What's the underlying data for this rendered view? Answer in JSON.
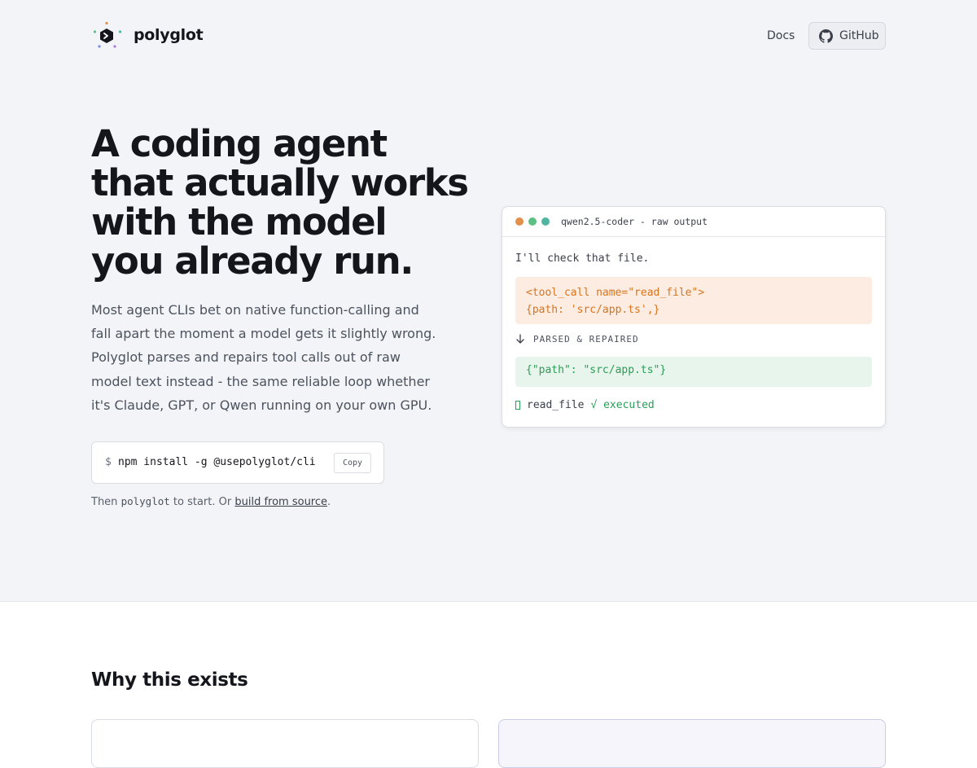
{
  "header": {
    "brand": "polyglot",
    "logo_icon": "polyglot-logo-icon",
    "nav": {
      "docs_label": "Docs",
      "github_label": "GitHub",
      "github_icon": "github-icon"
    }
  },
  "hero": {
    "headline_lines": [
      "A coding agent",
      "that actually works",
      "with the model",
      "you already run."
    ],
    "lede": "Most agent CLIs bet on native function-calling and fall apart the moment a model gets it slightly wrong. Polyglot parses and repairs tool calls out of raw model text instead - the same reliable loop whether it's Claude, GPT, or Qwen running on your own GPU.",
    "install": {
      "prompt": "$",
      "command": "npm install -g @usepolyglot/cli",
      "copy_label": "Copy"
    },
    "then": {
      "prefix": "Then ",
      "code": "polyglot",
      "middle": " to start. Or ",
      "link": "build from source",
      "suffix": "."
    }
  },
  "terminal": {
    "title": "qwen2.5-coder - raw output",
    "dots": [
      "#e2904a",
      "#5cbf83",
      "#4fb5a0"
    ],
    "intro": "I'll check that file.",
    "raw_lines": [
      "<tool_call name=\"read_file\">",
      "{path: 'src/app.ts',}"
    ],
    "parsed_label": "PARSED & REPAIRED",
    "parsed_icon": "arrow-down-icon",
    "json": "{\"path\": \"src/app.ts\"}",
    "exec_fn": "read_file",
    "exec_status": "√ executed"
  },
  "section": {
    "title": "Why this exists"
  },
  "colors": {
    "accent_orange": "#d8741e",
    "accent_green": "#2a9d56",
    "text": "#14161c",
    "hero_bg": "#f3f4f7"
  }
}
